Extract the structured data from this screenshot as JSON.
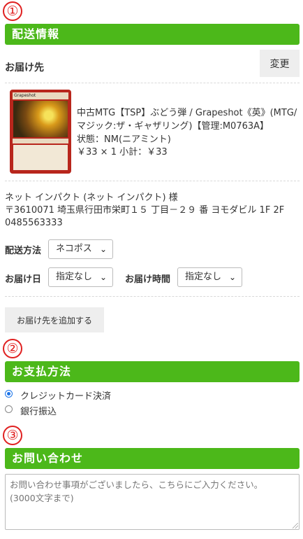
{
  "steps": [
    "①",
    "②",
    "③"
  ],
  "shipping": {
    "section_title": "配送情報",
    "destination_label": "お届け先",
    "change_button": "変更",
    "item": {
      "card_title": "Grapeshot",
      "name": "中古MTG【TSP】ぶどう弾 / Grapeshot《英》(MTG/マジック:ザ・ギャザリング)【管理:M0763A】",
      "condition": "状態：NM(ニアミント)",
      "price": "￥33 × 1  小計：￥33"
    },
    "address": {
      "name": "ネット インパクト (ネット インパクト) 様",
      "line": "〒3610071 埼玉県行田市栄町１５ 丁目－２９ 番 ヨモダビル 1F 2F",
      "phone": "0485563333"
    },
    "method_label": "配送方法",
    "method_value": "ネコポス",
    "date_label": "お届け日",
    "date_value": "指定なし",
    "time_label": "お届け時間",
    "time_value": "指定なし",
    "add_destination_button": "お届け先を追加する"
  },
  "payment": {
    "section_title": "お支払方法",
    "options": [
      {
        "label": "クレジットカード決済",
        "selected": true
      },
      {
        "label": "銀行振込",
        "selected": false
      }
    ]
  },
  "inquiry": {
    "section_title": "お問い合わせ",
    "placeholder": "お問い合わせ事項がございましたら、こちらにご入力ください。\n(3000文字まで)"
  },
  "colors": {
    "accent_green": "#4cb81a",
    "step_red": "#e02020",
    "radio_blue": "#1a73e8"
  }
}
